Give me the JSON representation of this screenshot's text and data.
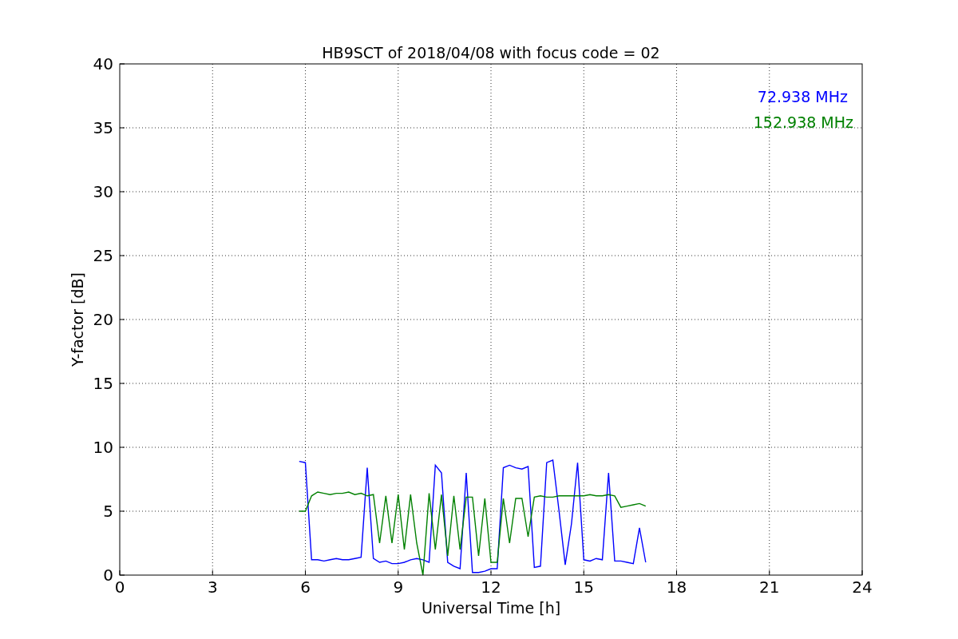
{
  "chart_data": {
    "type": "line",
    "title": "HB9SCT of 2018/04/08 with focus code = 02",
    "xlabel": "Universal Time [h]",
    "ylabel": "Y-factor [dB]",
    "x": [
      5.8,
      6.0,
      6.2,
      6.4,
      6.6,
      6.8,
      7.0,
      7.2,
      7.4,
      7.6,
      7.8,
      8.0,
      8.2,
      8.4,
      8.6,
      8.8,
      9.0,
      9.2,
      9.4,
      9.6,
      9.8,
      10.0,
      10.2,
      10.4,
      10.6,
      10.8,
      11.0,
      11.2,
      11.4,
      11.6,
      11.8,
      12.0,
      12.2,
      12.4,
      12.6,
      12.8,
      13.0,
      13.2,
      13.4,
      13.6,
      13.8,
      14.0,
      14.2,
      14.4,
      14.6,
      14.8,
      15.0,
      15.2,
      15.4,
      15.6,
      15.8,
      16.0,
      16.2,
      16.4,
      16.6,
      16.8,
      17.0
    ],
    "series": [
      {
        "name": "72.938 MHz",
        "color": "#0000ff",
        "values": [
          8.9,
          8.8,
          1.2,
          1.2,
          1.1,
          1.2,
          1.3,
          1.2,
          1.2,
          1.3,
          1.4,
          8.4,
          1.3,
          1.0,
          1.1,
          0.9,
          0.9,
          1.0,
          1.2,
          1.3,
          1.2,
          1.0,
          8.6,
          8.0,
          1.0,
          0.7,
          0.5,
          8.0,
          0.2,
          0.2,
          0.3,
          0.5,
          0.5,
          8.4,
          8.6,
          8.4,
          8.3,
          8.5,
          0.6,
          0.7,
          8.8,
          9.0,
          5.0,
          0.8,
          4.0,
          8.8,
          1.2,
          1.1,
          1.3,
          1.2,
          8.0,
          1.1,
          1.1,
          1.0,
          0.9,
          3.7,
          1.0
        ]
      },
      {
        "name": "152.938 MHz",
        "color": "#008000",
        "values": [
          5.0,
          5.0,
          6.2,
          6.5,
          6.4,
          6.3,
          6.4,
          6.4,
          6.5,
          6.3,
          6.4,
          6.2,
          6.3,
          2.5,
          6.2,
          2.5,
          6.3,
          2.0,
          6.3,
          2.5,
          0.0,
          6.4,
          2.0,
          6.3,
          1.5,
          6.2,
          2.0,
          6.1,
          6.1,
          1.5,
          6.0,
          1.0,
          1.0,
          6.0,
          2.5,
          6.0,
          6.0,
          3.0,
          6.1,
          6.2,
          6.1,
          6.1,
          6.2,
          6.2,
          6.2,
          6.2,
          6.2,
          6.3,
          6.2,
          6.2,
          6.3,
          6.2,
          5.3,
          5.4,
          5.5,
          5.6,
          5.4
        ]
      }
    ],
    "grid": true,
    "xlim": [
      0,
      24
    ],
    "ylim": [
      0,
      40
    ],
    "xticks": [
      0,
      3,
      6,
      9,
      12,
      15,
      18,
      21,
      24
    ],
    "yticks": [
      0,
      5,
      10,
      15,
      20,
      25,
      30,
      35,
      40
    ]
  }
}
